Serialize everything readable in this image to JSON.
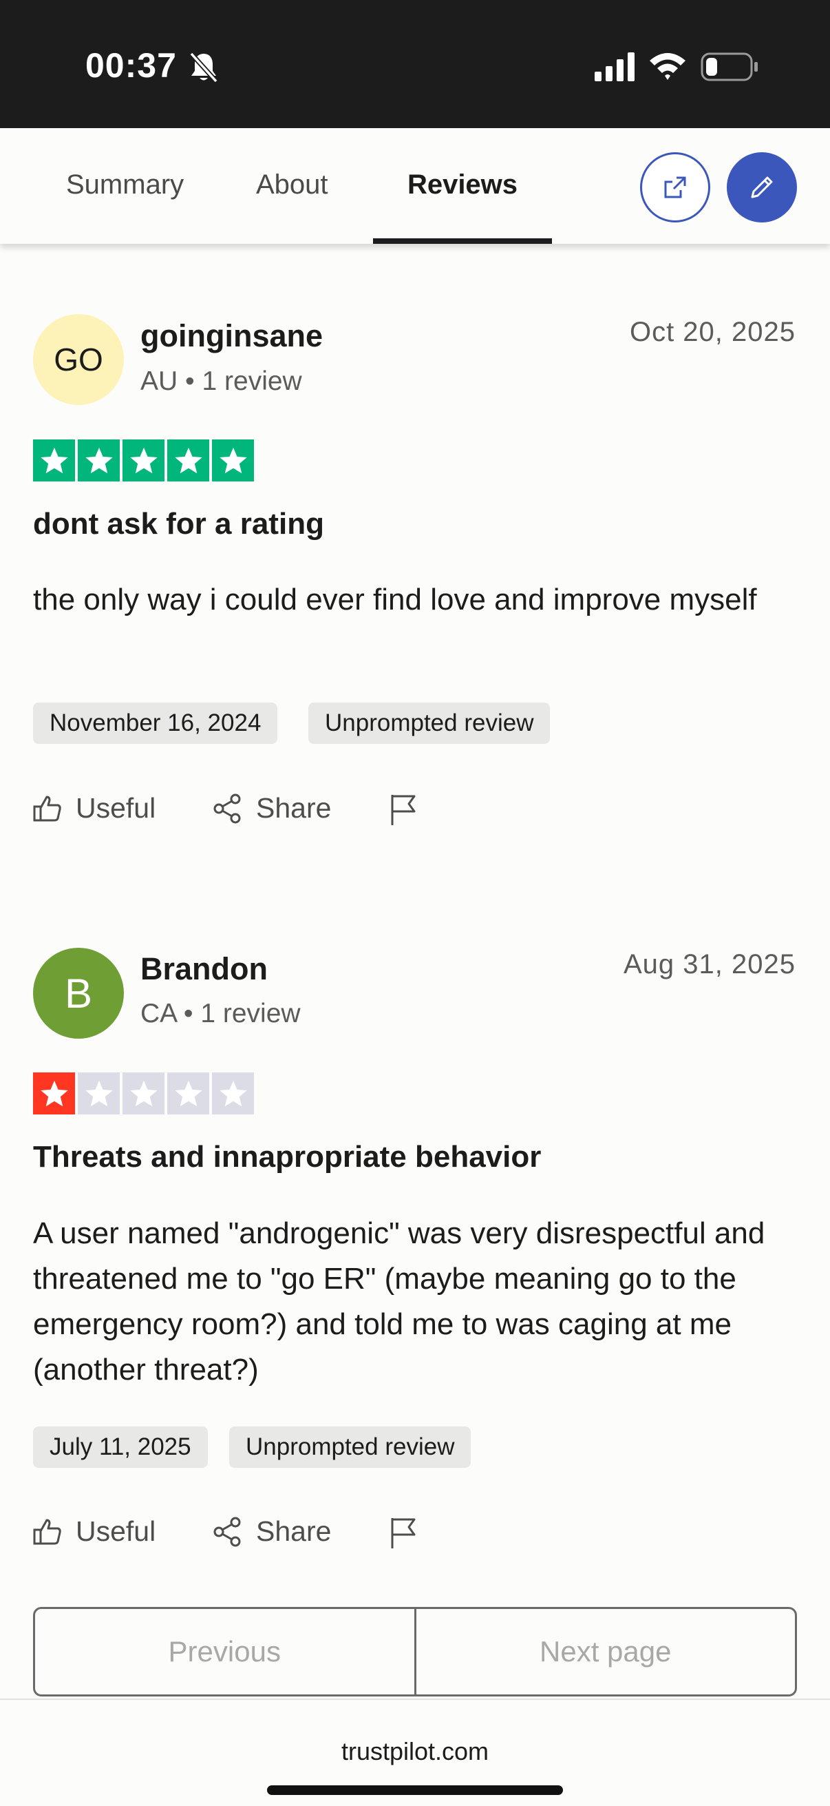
{
  "status_bar": {
    "time": "00:37"
  },
  "tabs": [
    {
      "label": "Summary",
      "active": false
    },
    {
      "label": "About",
      "active": false
    },
    {
      "label": "Reviews",
      "active": true
    }
  ],
  "colors": {
    "accent": "#3c57bc",
    "star_green": "#00b67a",
    "star_red": "#ff3722",
    "star_empty": "#dcdce6"
  },
  "reviews": [
    {
      "initials": "GO",
      "name": "goinginsane",
      "meta": "AU • 1 review",
      "date": "Oct 20, 2025",
      "rating": 5,
      "title": "dont ask for a rating",
      "body": "the only way i could ever find love and improve myself",
      "experience_date": "November 16, 2024",
      "tag": "Unprompted review",
      "actions": {
        "useful": "Useful",
        "share": "Share"
      }
    },
    {
      "initials": "B",
      "name": "Brandon",
      "meta": "CA • 1 review",
      "date": "Aug 31, 2025",
      "rating": 1,
      "title": "Threats and innapropriate behavior",
      "body": "A user named \"androgenic\" was very disrespectful and threatened me to \"go ER\" (maybe meaning go to the emergency room?) and told me to was caging at me (another threat?)",
      "experience_date": "July 11, 2025",
      "tag": "Unprompted review",
      "actions": {
        "useful": "Useful",
        "share": "Share"
      }
    }
  ],
  "pagination": {
    "previous": "Previous",
    "next": "Next page"
  },
  "browser": {
    "domain": "trustpilot.com"
  }
}
